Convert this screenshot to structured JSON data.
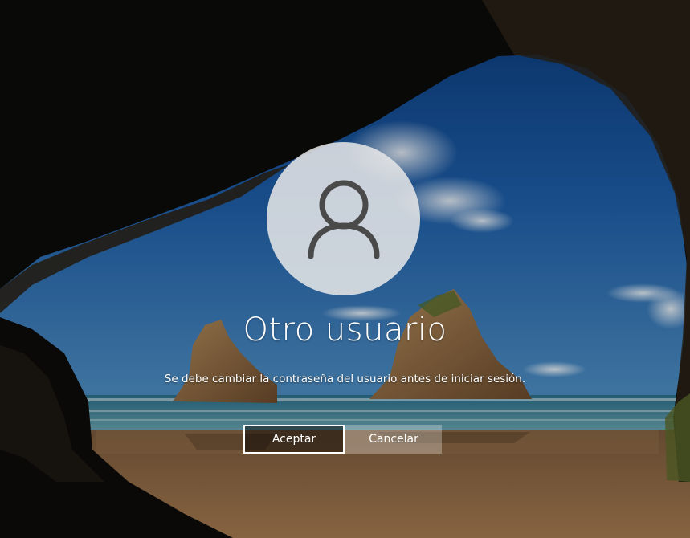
{
  "login": {
    "user_name": "Otro usuario",
    "message": "Se debe cambiar la contraseña del usuario antes de iniciar sesión.",
    "accept_label": "Aceptar",
    "cancel_label": "Cancelar",
    "avatar_icon": "user-icon"
  },
  "colors": {
    "text": "#ffffff",
    "avatar_bg": "#e8e8e8",
    "avatar_icon": "#4a4a4a",
    "button_border": "#ffffff"
  }
}
